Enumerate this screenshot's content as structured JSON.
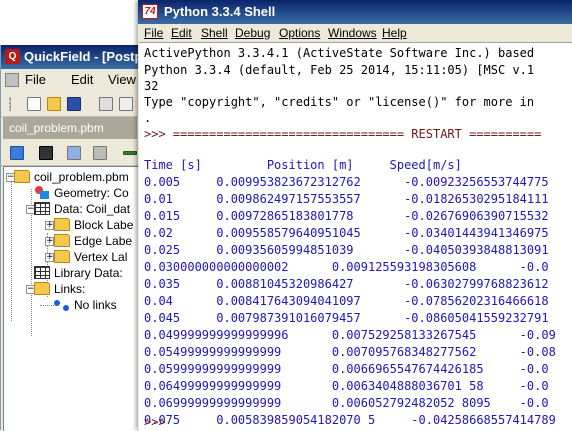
{
  "quickfield": {
    "title": "QuickField - [Postpr",
    "menu": [
      "File",
      "Edit",
      "View"
    ],
    "doc_tab": "coil_problem.pbm",
    "tree": {
      "root": "coil_problem.pbm",
      "geometry": "Geometry: Co",
      "data": "Data: Coil_dat",
      "block": "Block Labe",
      "edge": "Edge Labe",
      "vertex": "Vertex Lal",
      "library": "Library Data:",
      "links": "Links:",
      "no_links": "No links"
    }
  },
  "shell": {
    "title": "Python 3.3.4 Shell",
    "logo_text": "74",
    "menu": [
      "File",
      "Edit",
      "Shell",
      "Debug",
      "Options",
      "Windows",
      "Help"
    ],
    "banner": [
      "ActivePython 3.3.4.1 (ActiveState Software Inc.) based",
      "Python 3.3.4 (default, Feb 25 2014, 15:11:05) [MSC v.1",
      "32",
      "Type \"copyright\", \"credits\" or \"license()\" for more in",
      "."
    ],
    "restart": ">>> ================================ RESTART ==========",
    "output_header": "Time [s]         Position [m]     Speed[m/s]",
    "output_rows": [
      "0.005     0.009953823672312762      -0.00923256553744775",
      "0.01      0.009862497157553557      -0.01826530295184111",
      "0.015     0.00972865183801778       -0.02676906390715532",
      "0.02      0.009558579640951045      -0.03401443941346975",
      "0.025     0.00935605994851039       -0.04050393848813091",
      "0.030000000000000002      0.009125593198305608      -0.0",
      "0.035     0.00881045320986427       -0.06302799768823612",
      "0.04      0.008417643094041097      -0.07856202316466618",
      "0.045     0.007987391016079457      -0.08605041559232791",
      "0.049999999999999996      0.007529258133267545      -0.09",
      "0.05499999999999999       0.007095768348277562      -0.08",
      "0.05999999999999999       0.0066965547674426185     -0.0",
      "0.06499999999999999       0.0063404888036701 58     -0.0",
      "0.06999999999999999       0.006052792482052 8095    -0.0",
      "0.075     0.005839859054182070 5     -0.04258668557414789"
    ],
    "prompt": ">>>"
  }
}
